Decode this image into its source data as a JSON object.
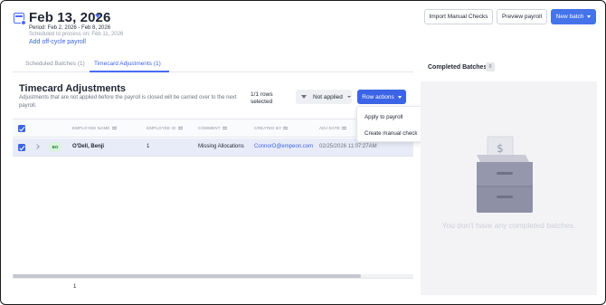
{
  "header": {
    "date_title": "Feb 13, 2026",
    "period": "Period: Feb 2, 2026 - Feb 8, 2026",
    "scheduled": "Scheduled to process on: Feb 11, 2026",
    "add_offcycle": "Add off-cycle payroll",
    "import_label": "Import Manual Checks",
    "preview_label": "Preview payroll",
    "new_batch_label": "New batch"
  },
  "tabs": [
    {
      "label": "Scheduled Batches (1)",
      "active": false
    },
    {
      "label": "Timecard Adjustments (1)",
      "active": true
    }
  ],
  "section": {
    "title": "Timecard Adjustments",
    "description": "Adjustments that are not applied before the payroll is closed will be carried over to the next payroll.",
    "rows_selected": "1/1 rows selected",
    "filter_label": "Not applied",
    "row_actions_label": "Row actions"
  },
  "table": {
    "columns": [
      "EMPLOYEE NAME",
      "EMPLOYEE ID",
      "COMMENT",
      "CREATED BY",
      "ADJ DATE"
    ],
    "rows": [
      {
        "initials": "BO",
        "employee_name": "O'Dell, Benji",
        "employee_id": "1",
        "comment": "Missing Allocations",
        "created_by": "ConnorO@empeon.com",
        "adj_date": "02/25/2026 11:07:27AM"
      }
    ],
    "page": "1",
    "scroll_fraction": 0.87
  },
  "row_actions_menu": {
    "items": [
      "Apply to payroll",
      "Create manual check"
    ]
  },
  "right_panel": {
    "title": "Completed Batches",
    "count": "0",
    "empty_text": "You don't have any completed batches."
  },
  "colors": {
    "accent": "#4573ea",
    "selected_row": "#e8ecf8",
    "badge_bg": "#d9f3dc",
    "panel_bg": "#f3f3f6"
  }
}
